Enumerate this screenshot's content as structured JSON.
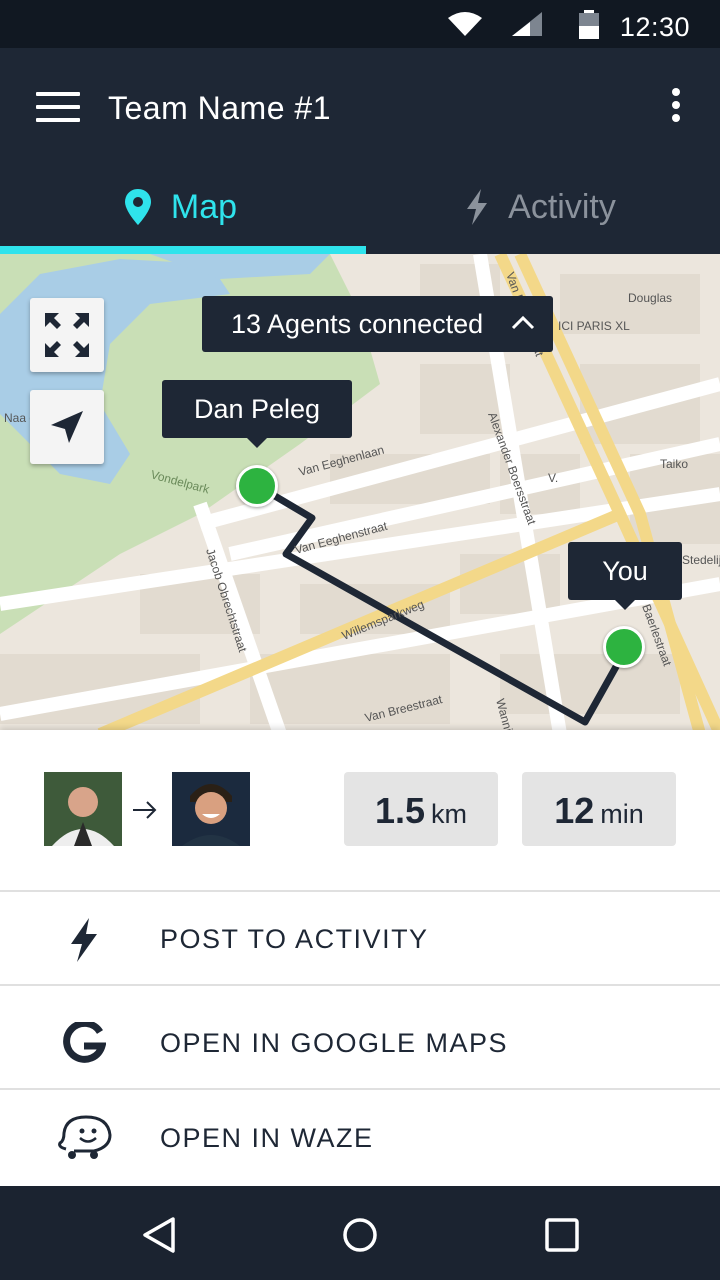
{
  "status_bar": {
    "time": "12:30",
    "icons": [
      "wifi-icon",
      "signal-icon",
      "battery-icon"
    ]
  },
  "header": {
    "team_name": "Team Name #1"
  },
  "tabs": [
    {
      "label": "Map",
      "icon": "map-pin-icon",
      "active": true
    },
    {
      "label": "Activity",
      "icon": "lightning-icon",
      "active": false
    }
  ],
  "map": {
    "agents_connected": "13 Agents connected",
    "markers": [
      {
        "label": "Dan Peleg"
      },
      {
        "label": "You"
      }
    ],
    "street_labels": [
      "Van Eeghenlaan",
      "Van Eeghenstraat",
      "Alexander Boersstraat",
      "Jacob Obrechtstraat",
      "Willemsparkweg",
      "Van Breestraat",
      "Vondelpark",
      "Douglas",
      "ICI PARIS XL",
      "Taiko",
      "Stedelijk Ams",
      "Naa door P",
      "Wanning",
      "Van Baerlestraat",
      "V.",
      "Baerlestraat"
    ],
    "colors": {
      "route": "#1e2735",
      "pin": "#2db340"
    }
  },
  "route": {
    "distance_value": "1.5",
    "distance_unit": "km",
    "duration_value": "12",
    "duration_unit": "min"
  },
  "actions": [
    {
      "label": "POST TO ACTIVITY",
      "icon": "lightning-icon"
    },
    {
      "label": "OPEN IN GOOGLE MAPS",
      "icon": "google-icon"
    },
    {
      "label": "OPEN IN WAZE",
      "icon": "waze-icon"
    }
  ],
  "theme": {
    "primary_dark": "#1e2735",
    "accent": "#2fe3ec"
  }
}
